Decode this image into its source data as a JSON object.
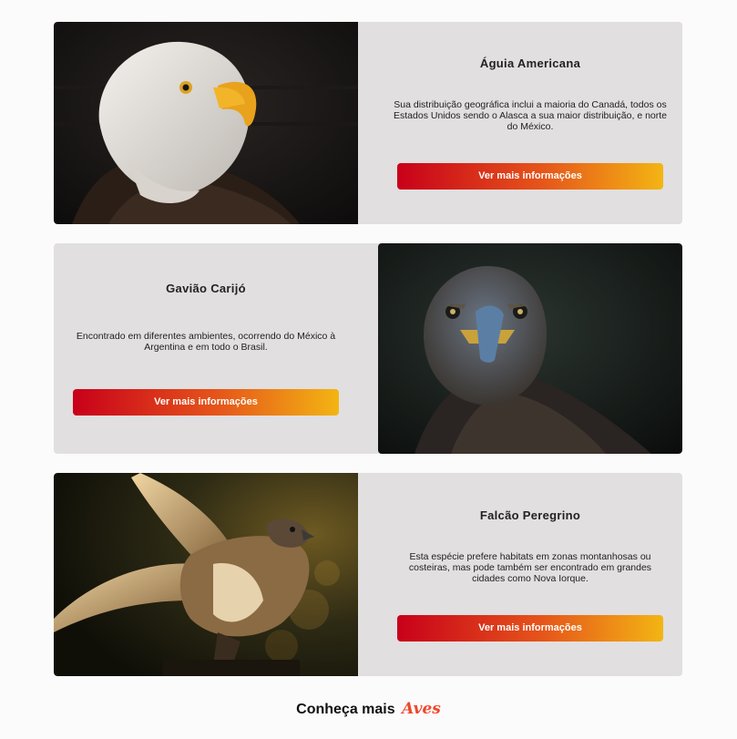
{
  "cards": [
    {
      "title": "Águia Americana",
      "description": "Sua distribuição geográfica inclui a maioria do Canadá, todos os Estados Unidos sendo o Alasca a sua maior distribuição, e norte do México.",
      "button": "Ver mais informações",
      "image": "bald-eagle-photo"
    },
    {
      "title": "Gavião Carijó",
      "description": "Encontrado em diferentes ambientes, ocorrendo do México à Argentina e em todo o Brasil.",
      "button": "Ver mais informações",
      "image": "hawk-photo"
    },
    {
      "title": "Falcão Peregrino",
      "description": "Esta espécie prefere habitats em zonas montanhosas ou costeiras, mas pode também ser encontrado em grandes cidades como Nova Iorque.",
      "button": "Ver mais informações",
      "image": "peregrine-falcon-photo"
    }
  ],
  "footer": {
    "text": "Conheça mais",
    "brand": "Aves"
  },
  "colors": {
    "page_bg": "#fcfbfc",
    "card_bg": "#e1dfe0",
    "button_gradient_start": "#c8001a",
    "button_gradient_end": "#f3b513",
    "brand": "#f0462a"
  }
}
